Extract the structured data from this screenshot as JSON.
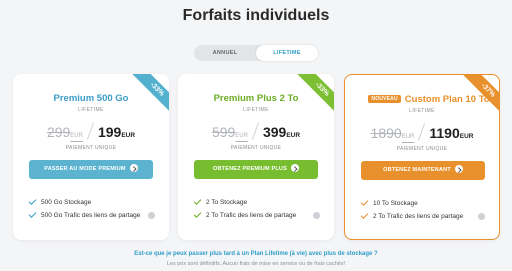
{
  "page": {
    "title": "Forfaits individuels"
  },
  "billing_toggle": {
    "options": [
      "ANNUEL",
      "LIFETIME"
    ],
    "selected": "LIFETIME"
  },
  "plans": [
    {
      "discount": "-33%",
      "name": "Premium 500 Go",
      "badge": "",
      "subtitle": "LIFETIME",
      "old_price": "299",
      "old_currency": "EUR",
      "price": "199",
      "currency": "EUR",
      "payment_note": "PAIEMENT UNIQUE",
      "cta": "PASSER AU MODE PREMIUM",
      "features": [
        "500 Go Stockage",
        "500 Go Trafic des liens de partage"
      ],
      "accent": "#53b1cf"
    },
    {
      "discount": "-33%",
      "name": "Premium Plus 2 To",
      "badge": "",
      "subtitle": "LIFETIME",
      "old_price": "599",
      "old_currency": "EUR",
      "price": "399",
      "currency": "EUR",
      "payment_note": "PAIEMENT UNIQUE",
      "cta": "OBTENEZ PREMIUM PLUS",
      "features": [
        "2 To Stockage",
        "2 To Trafic des liens de partage"
      ],
      "accent": "#7cbf32"
    },
    {
      "discount": "-37%",
      "name": "Custom Plan 10 To",
      "badge": "NOUVEAU",
      "subtitle": "LIFETIME",
      "old_price": "1890",
      "old_currency": "EUR",
      "price": "1190",
      "currency": "EUR",
      "payment_note": "PAIEMENT UNIQUE",
      "cta": "OBTENEZ MAINTENANT",
      "features": [
        "10 To Stockage",
        "2 To Trafic des liens de partage"
      ],
      "accent": "#e8902b"
    }
  ],
  "faq": {
    "question": "Est-ce que je peux passer plus tard à un Plan Lifetime (à vie) avec plus de stockage ?",
    "answer": "Les prix sont définitifs. Aucun frais de mise en service ou de frais cachés!"
  }
}
